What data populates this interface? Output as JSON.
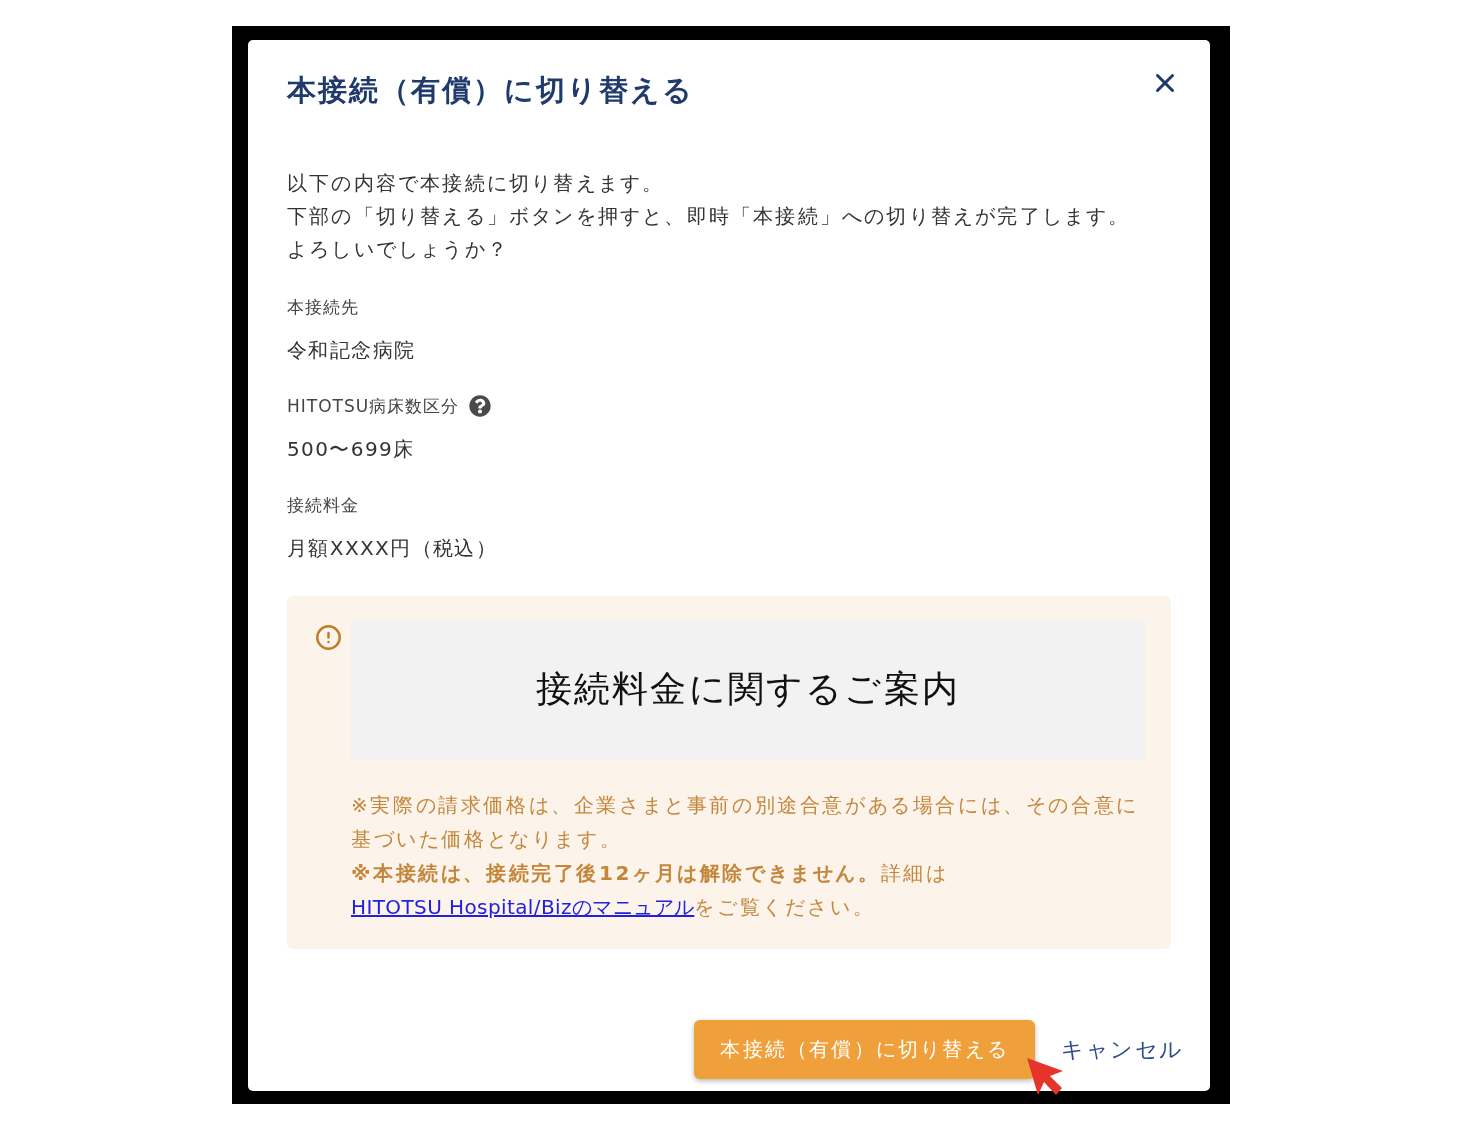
{
  "dialog": {
    "title": "本接続（有償）に切り替える",
    "intro": [
      "以下の内容で本接続に切り替えます。",
      "下部の「切り替える」ボタンを押すと、即時「本接続」への切り替えが完了します。",
      "よろしいでしょうか？"
    ],
    "fields": [
      {
        "label": "本接続先",
        "value": "令和記念病院",
        "help": false
      },
      {
        "label": "HITOTSU病床数区分",
        "value": "500〜699床",
        "help": true
      },
      {
        "label": "接続料金",
        "value": "月額XXXX円（税込）",
        "help": false
      }
    ],
    "notice": {
      "heading": "接続料金に関するご案内",
      "notes": [
        {
          "text": "※実際の請求価格は、企業さまと事前の別途合意がある場合には、その合意に基づいた価格となります。"
        },
        {
          "text": "**※本接続は、接続完了後12ヶ月は解除できません。**詳細は",
          "link": "HITOTSU Hospital/Bizのマニュアル",
          "after": "をご覧ください。"
        }
      ]
    },
    "buttons": [
      {
        "kind": "primary",
        "label": "本接続（有償）に切り替える"
      },
      {
        "kind": "text",
        "label": "キャンセル"
      }
    ]
  }
}
